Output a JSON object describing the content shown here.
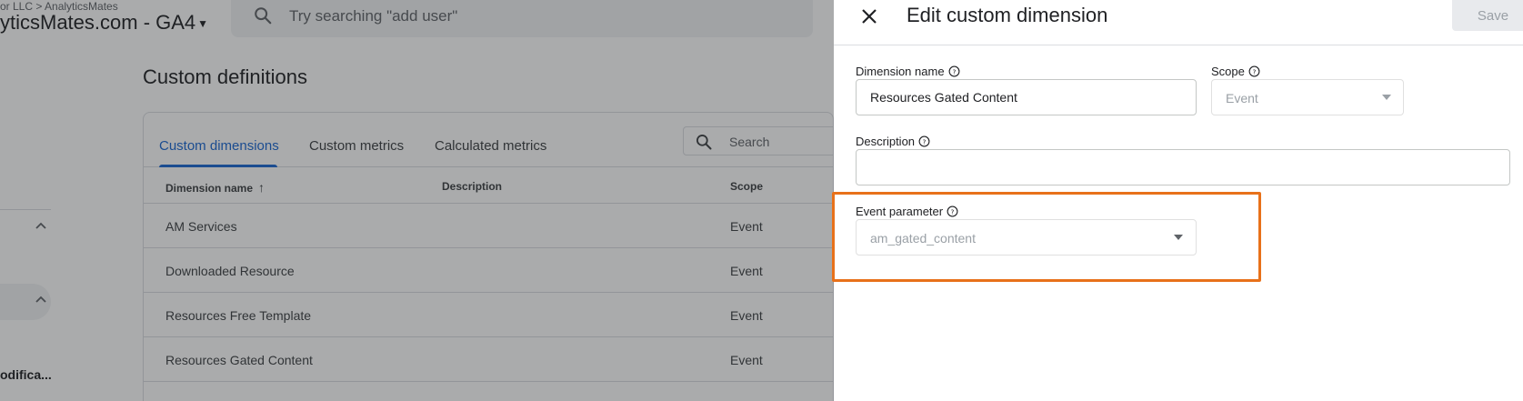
{
  "topbar": {
    "account_crumb": "or LLC > AnalyticsMates",
    "property_name": "yticsMates.com - GA4",
    "search_placeholder": "Try searching \"add user\""
  },
  "leftnav": {
    "truncated_item": "odifica..."
  },
  "page": {
    "title": "Custom definitions",
    "tabs": [
      {
        "label": "Custom dimensions",
        "active": true
      },
      {
        "label": "Custom metrics",
        "active": false
      },
      {
        "label": "Calculated metrics",
        "active": false
      }
    ],
    "search_placeholder": "Search",
    "columns": [
      "Dimension name",
      "Description",
      "Scope"
    ],
    "rows": [
      {
        "name": "AM Services",
        "description": "",
        "scope": "Event"
      },
      {
        "name": "Downloaded Resource",
        "description": "",
        "scope": "Event"
      },
      {
        "name": "Resources Free Template",
        "description": "",
        "scope": "Event"
      },
      {
        "name": "Resources Gated Content",
        "description": "",
        "scope": "Event"
      }
    ]
  },
  "panel": {
    "title": "Edit custom dimension",
    "save_label": "Save",
    "dimension_name_label": "Dimension name",
    "dimension_name_value": "Resources Gated Content",
    "scope_label": "Scope",
    "scope_value": "Event",
    "description_label": "Description",
    "description_value": "",
    "event_parameter_label": "Event parameter",
    "event_parameter_value": "am_gated_content"
  },
  "colors": {
    "accent": "#1967d2",
    "highlight": "#e8711a"
  }
}
